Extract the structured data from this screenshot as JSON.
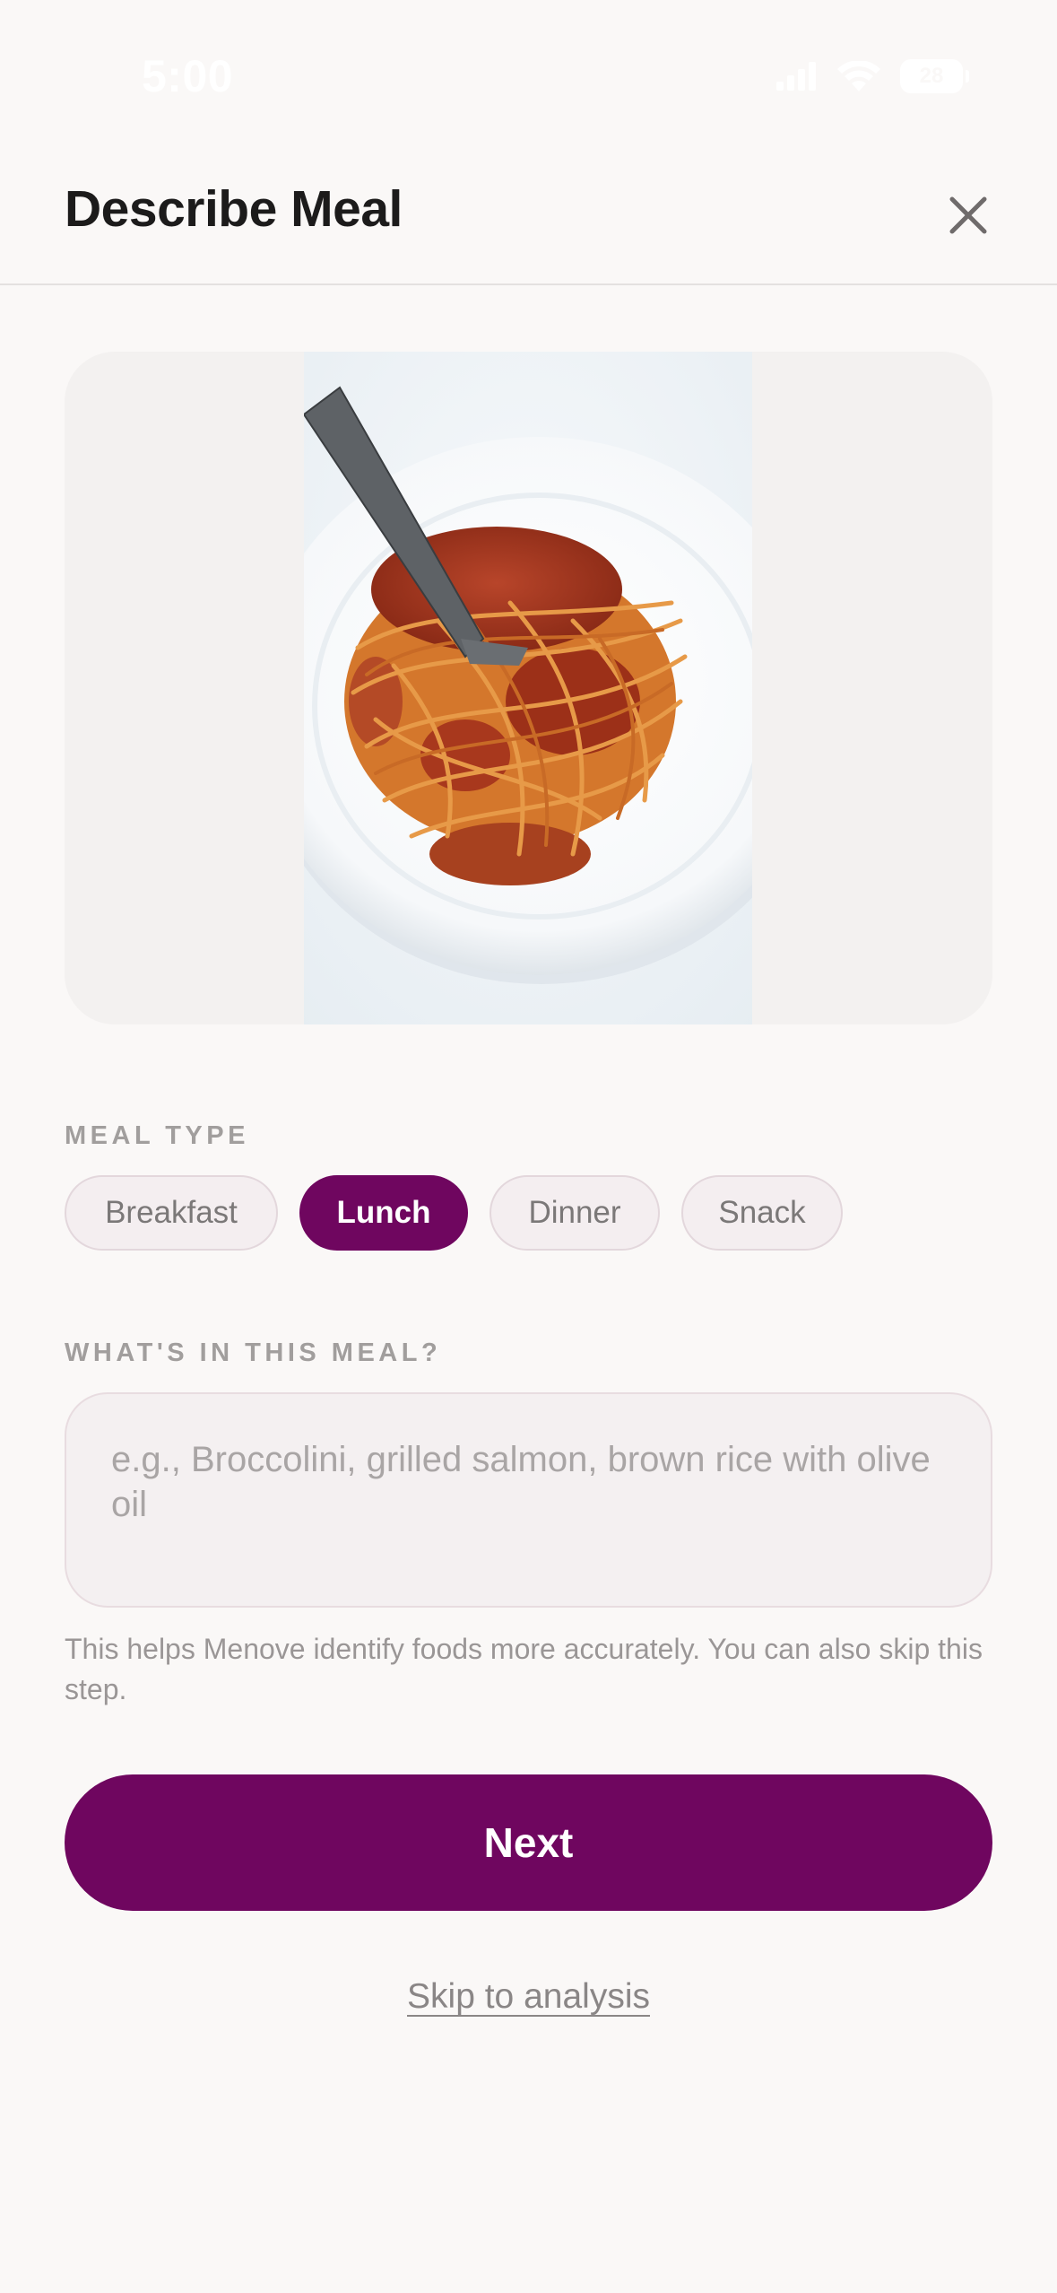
{
  "status_bar": {
    "time": "5:00",
    "battery_level": "28",
    "icons": [
      "cellular-signal-icon",
      "wifi-icon",
      "battery-icon"
    ]
  },
  "header": {
    "title": "Describe Meal",
    "close_icon": "close-icon"
  },
  "photo": {
    "subject": "spaghetti-bolognese-plate"
  },
  "meal_type": {
    "label": "MEAL TYPE",
    "options": [
      {
        "label": "Breakfast",
        "selected": false
      },
      {
        "label": "Lunch",
        "selected": true
      },
      {
        "label": "Dinner",
        "selected": false
      },
      {
        "label": "Snack",
        "selected": false
      }
    ]
  },
  "description": {
    "label": "WHAT'S IN THIS MEAL?",
    "value": "",
    "placeholder": "e.g., Broccolini, grilled salmon, brown rice with olive oil",
    "helper": "This helps Menove identify foods more accurately. You can also skip this step."
  },
  "actions": {
    "next_label": "Next",
    "skip_label": "Skip to analysis"
  },
  "colors": {
    "accent": "#6f065f",
    "background": "#faf8f7",
    "chip_background": "#f4eef0",
    "muted_text": "#a19e9d"
  }
}
